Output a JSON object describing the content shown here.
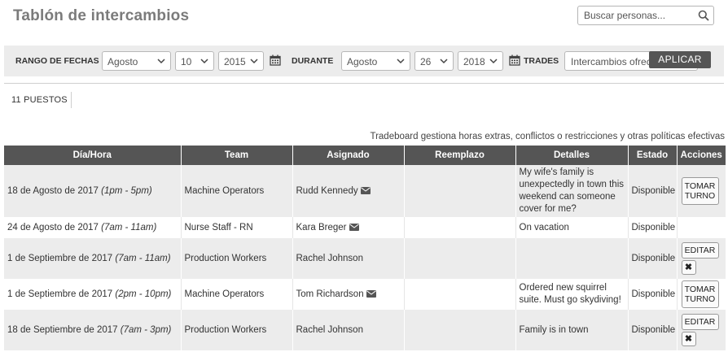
{
  "header": {
    "title": "Tablón de intercambios",
    "search_placeholder": "Buscar personas..."
  },
  "filters": {
    "range_label": "RANGO DE FECHAS",
    "from": {
      "month": "Agosto",
      "day": "10",
      "year": "2015"
    },
    "during_label": "DURANTE",
    "to": {
      "month": "Agosto",
      "day": "26",
      "year": "2018"
    },
    "trades_label": "TRADES",
    "trades_value": "Intercambios ofrecidos",
    "apply_label": "APLICAR"
  },
  "count_label": "11 PUESTOS",
  "note": "Tradeboard gestiona horas extras, conflictos o restricciones y otras políticas efectivas",
  "table": {
    "headers": [
      "Día/Hora",
      "Team",
      "Asignado",
      "Reemplazo",
      "Detalles",
      "Estado",
      "Acciones"
    ],
    "rows": [
      {
        "date": "18 de Agosto de 2017",
        "time": "(1pm - 5pm)",
        "team": "Machine Operators",
        "assigned": "Rudd Kennedy",
        "mail": true,
        "replacement": "",
        "details": "My wife's family is unexpectedly in town this weekend can someone cover for me?",
        "status": "Disponible",
        "action": "TOMAR TURNO"
      },
      {
        "date": "24 de Agosto de 2017",
        "time": "(7am - 11am)",
        "team": "Nurse Staff - RN",
        "assigned": "Kara Breger",
        "mail": true,
        "replacement": "",
        "details": "On vacation",
        "status": "Disponible",
        "action": ""
      },
      {
        "date": "1 de Septiembre de 2017",
        "time": "(7am - 11am)",
        "team": "Production Workers",
        "assigned": "Rachel Johnson",
        "mail": false,
        "replacement": "",
        "details": "",
        "status": "Disponible",
        "action": "EDITAR"
      },
      {
        "date": "1 de Septiembre de 2017",
        "time": "(2pm - 10pm)",
        "team": "Machine Operators",
        "assigned": "Tom Richardson",
        "mail": true,
        "replacement": "",
        "details": "Ordered new squirrel suite. Must go skydiving!",
        "status": "Disponible",
        "action": "TOMAR TURNO"
      },
      {
        "date": "18 de Septiembre de 2017",
        "time": "(7am - 3pm)",
        "team": "Production Workers",
        "assigned": "Rachel Johnson",
        "mail": false,
        "replacement": "",
        "details": "Family is in town",
        "status": "Disponible",
        "action": "EDITAR"
      }
    ]
  },
  "delete_glyph": "✖",
  "icons": {
    "search": "magnifier-icon",
    "calendar": "calendar-icon",
    "mail": "envelope-icon",
    "dropdown": "chevron-down-icon",
    "delete": "close-icon"
  },
  "colors": {
    "header_bg": "#555555",
    "row_alt": "#ececec",
    "filter_bg": "#ececec",
    "title": "#7b7b7b"
  }
}
